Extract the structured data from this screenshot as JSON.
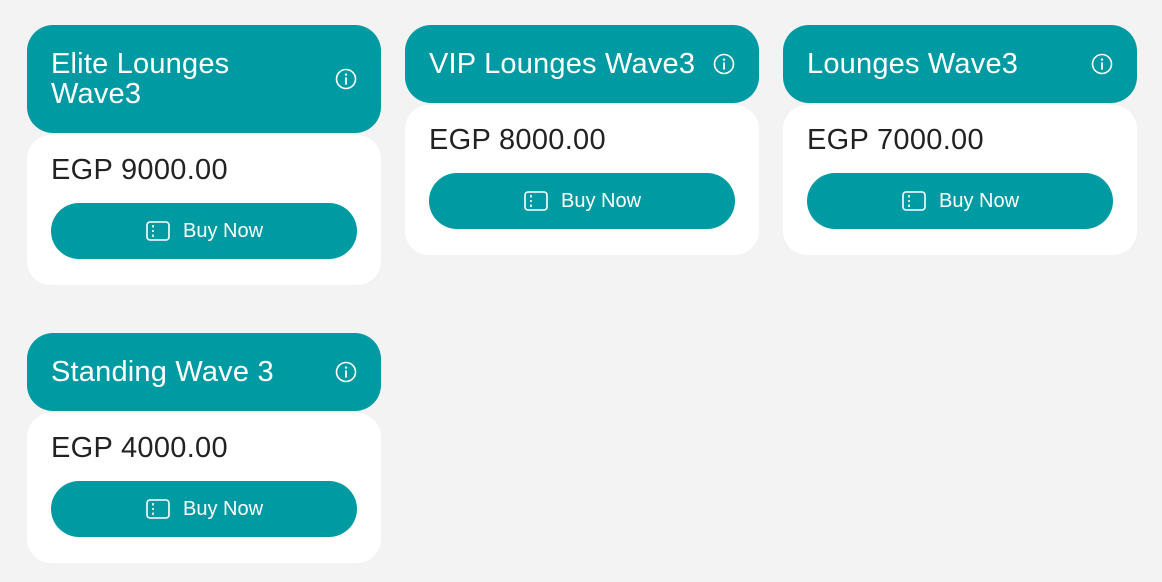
{
  "cards": [
    {
      "title": "Elite Lounges Wave3",
      "price": "EGP 9000.00",
      "button_label": "Buy Now"
    },
    {
      "title": "VIP Lounges Wave3",
      "price": "EGP 8000.00",
      "button_label": "Buy Now"
    },
    {
      "title": "Lounges Wave3",
      "price": "EGP 7000.00",
      "button_label": "Buy Now"
    },
    {
      "title": "Standing Wave 3",
      "price": "EGP 4000.00",
      "button_label": "Buy Now"
    }
  ],
  "icons": {
    "info": "info-icon",
    "ticket": "ticket-icon"
  },
  "colors": {
    "accent": "#009aa2",
    "background": "#f3f3f3",
    "card": "#ffffff"
  }
}
